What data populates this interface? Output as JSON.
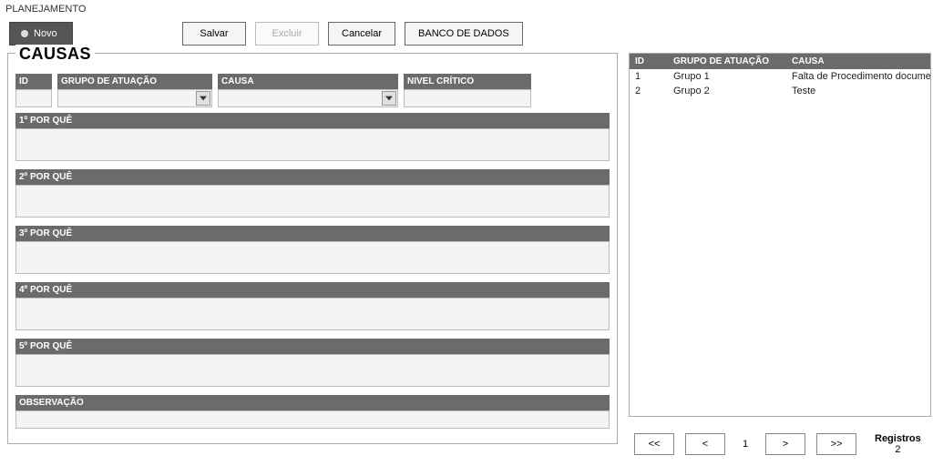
{
  "title": "PLANEJAMENTO",
  "toolbar": {
    "novo": "Novo",
    "salvar": "Salvar",
    "excluir": "Excluir",
    "cancelar": "Cancelar",
    "banco": "BANCO DE DADOS"
  },
  "form": {
    "legend": "CAUSAS",
    "fields": {
      "id": {
        "label": "ID",
        "value": ""
      },
      "grupo": {
        "label": "GRUPO DE ATUAÇÃO",
        "value": ""
      },
      "causa": {
        "label": "CAUSA",
        "value": ""
      },
      "nivel": {
        "label": "NIVEL CRÍTICO",
        "value": ""
      }
    },
    "sections": {
      "pq1": {
        "label": "1º POR QUÊ",
        "value": ""
      },
      "pq2": {
        "label": "2º POR QUÊ",
        "value": ""
      },
      "pq3": {
        "label": "3º POR QUÊ",
        "value": ""
      },
      "pq4": {
        "label": "4º POR QUÊ",
        "value": ""
      },
      "pq5": {
        "label": "5º POR QUÊ",
        "value": ""
      },
      "obs": {
        "label": "OBSERVAÇÃO",
        "value": ""
      }
    }
  },
  "grid": {
    "headers": {
      "id": "ID",
      "grupo": "GRUPO DE ATUAÇÃO",
      "causa": "CAUSA"
    },
    "rows": [
      {
        "id": "1",
        "grupo": "Grupo 1",
        "causa": "Falta de Procedimento documentado"
      },
      {
        "id": "2",
        "grupo": "Grupo 2",
        "causa": "Teste"
      }
    ]
  },
  "pager": {
    "first": "<<",
    "prev": "<",
    "page": "1",
    "next": ">",
    "last": ">>",
    "registros_label": "Registros",
    "registros_count": "2"
  }
}
